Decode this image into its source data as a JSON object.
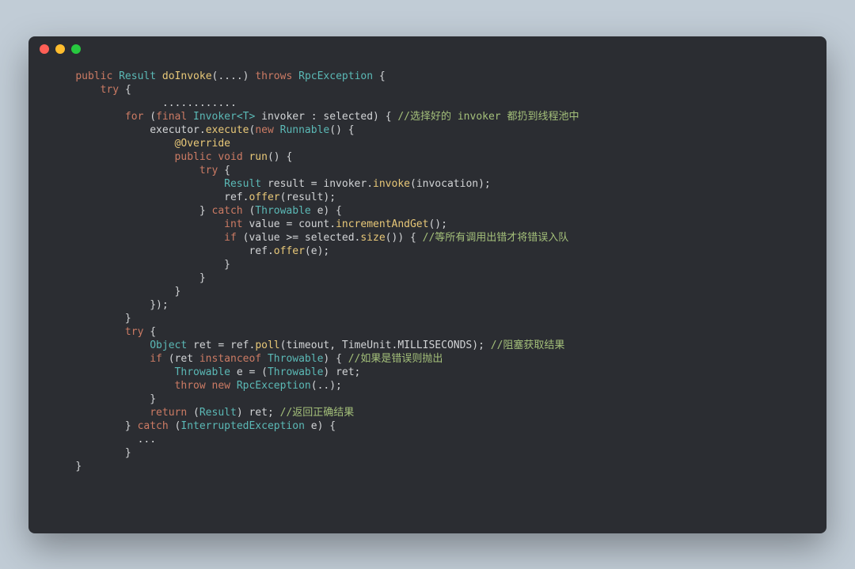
{
  "traffic": {
    "red": "close",
    "yellow": "minimize",
    "green": "zoom"
  },
  "code": {
    "l1": {
      "kw1": "public",
      "type1": "Result",
      "fn": "doInvoke",
      "args": "(....)",
      "kw2": "throws",
      "type2": "RpcException",
      "brace": "{"
    },
    "l2": {
      "kw": "try",
      "brace": "{"
    },
    "l3": {
      "dots": "............"
    },
    "l4": {
      "kw": "for",
      "open": "(",
      "kw2": "final",
      "type": "Invoker",
      "gen": "<T>",
      "var": "invoker",
      "colon": ":",
      "sel": "selected",
      "close": ") {",
      "cm": "//选择好的 invoker 都扔到线程池中"
    },
    "l5": {
      "obj": "executor",
      "dot": ".",
      "m": "execute",
      "open": "(",
      "kw": "new",
      "type": "Runnable",
      "close": "() {"
    },
    "l6": {
      "ann": "@Override"
    },
    "l7": {
      "kw": "public",
      "kw2": "void",
      "fn": "run",
      "close": "() {"
    },
    "l8": {
      "kw": "try",
      "brace": "{"
    },
    "l9": {
      "type": "Result",
      "var": "result",
      "eq": "=",
      "obj": "invoker",
      "dot": ".",
      "m": "invoke",
      "open": "(",
      "arg": "invocation",
      "close": ");"
    },
    "l10": {
      "obj": "ref",
      "dot": ".",
      "m": "offer",
      "open": "(",
      "arg": "result",
      "close": ");"
    },
    "l11": {
      "brace": "}",
      "kw": "catch",
      "open": "(",
      "type": "Throwable",
      "var": "e",
      "close": ") {"
    },
    "l12": {
      "kw": "int",
      "var": "value",
      "eq": "=",
      "obj": "count",
      "dot": ".",
      "m": "incrementAndGet",
      "close": "();"
    },
    "l13": {
      "kw": "if",
      "open": "(",
      "cond1": "value >= selected.",
      "m": "size",
      "close": "()) {",
      "cm": "//等所有调用出错才将错误入队"
    },
    "l14": {
      "obj": "ref",
      "dot": ".",
      "m": "offer",
      "open": "(",
      "arg": "e",
      "close": ");"
    },
    "l15": {
      "brace": "}"
    },
    "l16": {
      "brace": "}"
    },
    "l17": {
      "brace": "}"
    },
    "l18": {
      "close": "});"
    },
    "l19": {
      "brace": "}"
    },
    "l20": {
      "kw": "try",
      "brace": "{"
    },
    "l21": {
      "type": "Object",
      "var": "ret",
      "eq": "=",
      "obj": "ref",
      "dot": ".",
      "m": "poll",
      "open": "(",
      "args": "timeout, TimeUnit.MILLISECONDS",
      "close": ");",
      "cm": "//阻塞获取结果"
    },
    "l22": {
      "kw": "if",
      "open": "(",
      "cond": "ret",
      "kw2": "instanceof",
      "type": "Throwable",
      "close": ") {",
      "cm": "//如果是错误则抛出"
    },
    "l23": {
      "type": "Throwable",
      "var": "e",
      "eq": "=",
      "open": "(",
      "type2": "Throwable",
      "close": ") ret;"
    },
    "l24": {
      "kw": "throw",
      "kw2": "new",
      "type": "RpcException",
      "close": "(..);"
    },
    "l25": {
      "brace": "}"
    },
    "l26": {
      "kw": "return",
      "open": "(",
      "type": "Result",
      "close": ") ret;",
      "cm": "//返回正确结果"
    },
    "l27": {
      "brace": "}",
      "kw": "catch",
      "open": "(",
      "type": "InterruptedException",
      "var": "e",
      "close": ") {"
    },
    "l28": {
      "dots": "..."
    },
    "l29": {
      "brace": "}"
    },
    "l30": {
      "brace": "}"
    }
  }
}
